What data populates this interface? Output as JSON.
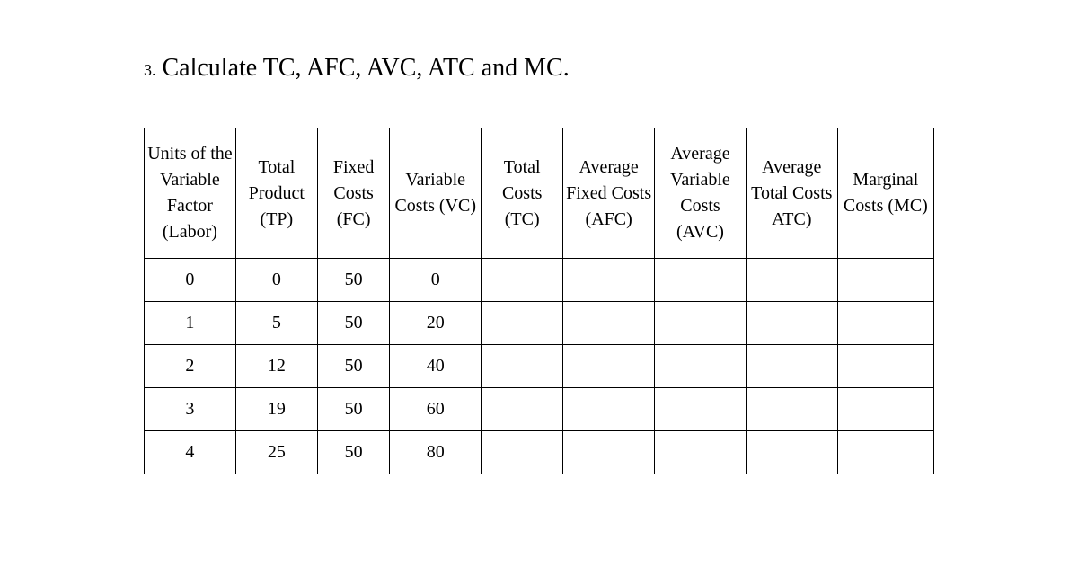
{
  "title_number": "3.",
  "title_text": "Calculate TC, AFC, AVC, ATC and MC.",
  "headers": {
    "labor": "Units of the Variable Factor (Labor)",
    "tp": "Total Product (TP)",
    "fc": "Fixed Costs (FC)",
    "vc": "Variable Costs (VC)",
    "tc": "Total Costs (TC)",
    "afc": "Average Fixed Costs (AFC)",
    "avc": "Average Variable Costs (AVC)",
    "atc": "Average Total Costs ATC)",
    "mc": "Marginal Costs (MC)"
  },
  "rows": [
    {
      "labor": "0",
      "tp": "0",
      "fc": "50",
      "vc": "0",
      "tc": "",
      "afc": "",
      "avc": "",
      "atc": "",
      "mc": ""
    },
    {
      "labor": "1",
      "tp": "5",
      "fc": "50",
      "vc": "20",
      "tc": "",
      "afc": "",
      "avc": "",
      "atc": "",
      "mc": ""
    },
    {
      "labor": "2",
      "tp": "12",
      "fc": "50",
      "vc": "40",
      "tc": "",
      "afc": "",
      "avc": "",
      "atc": "",
      "mc": ""
    },
    {
      "labor": "3",
      "tp": "19",
      "fc": "50",
      "vc": "60",
      "tc": "",
      "afc": "",
      "avc": "",
      "atc": "",
      "mc": ""
    },
    {
      "labor": "4",
      "tp": "25",
      "fc": "50",
      "vc": "80",
      "tc": "",
      "afc": "",
      "avc": "",
      "atc": "",
      "mc": ""
    }
  ]
}
